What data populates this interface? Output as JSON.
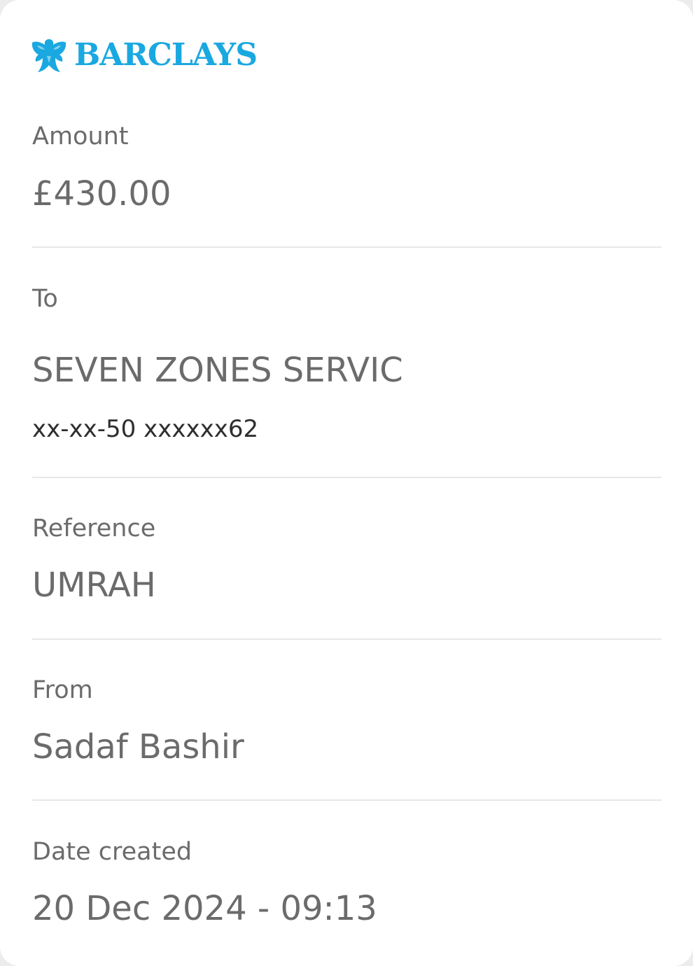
{
  "brand": {
    "name": "BARCLAYS",
    "logo_icon": "eagle-logo",
    "color": "#1aa8e0"
  },
  "amount": {
    "label": "Amount",
    "value": "£430.00"
  },
  "to": {
    "label": "To",
    "name": "SEVEN ZONES SERVIC",
    "account": "xx-xx-50 xxxxxx62"
  },
  "reference": {
    "label": "Reference",
    "value": "UMRAH"
  },
  "from": {
    "label": "From",
    "value": "Sadaf Bashir"
  },
  "date_created": {
    "label": "Date created",
    "value": "20 Dec 2024 - 09:13"
  }
}
